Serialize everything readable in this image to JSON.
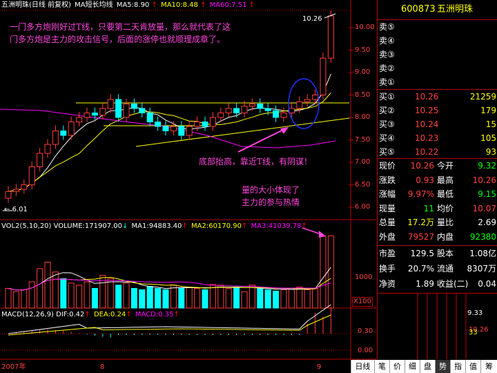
{
  "price_header": {
    "stock_name": "五洲明珠",
    "chart_mode": "(日线 前复权)",
    "indicator": "MA短长均线",
    "ma5": "MA5:8.90",
    "ma10": "MA10:8.48",
    "ma60": "MA60:7.51",
    "up_arrow": "↑"
  },
  "annotations": {
    "top_note_line1": "一门多方炮刚好过T线，只要第二天肯放量，那么就代表了这",
    "top_note_line2": "门多方炮是主力的攻击信号，后面的涨停也就顺理成章了。",
    "bottom_note": "底部抬高，靠近T线，有阴谋！",
    "volume_note_line1": "量的大小体现了",
    "volume_note_line2": "主力的参与热情",
    "high_label": "10.26",
    "low_label": "6.01"
  },
  "price_axis": [
    "10.00",
    "9.50",
    "9.00",
    "8.50",
    "8.00",
    "7.50",
    "7.00",
    "6.50",
    "6.00"
  ],
  "volume_header": {
    "title": "VOL2(5,10,20)",
    "volume": "VOLUME:171907.00",
    "ma1": "MA1:94883.40",
    "ma2": "MA2:60170.90",
    "ma3": "MA3:41039.78",
    "arrow": "↑",
    "down_arrow": "↓"
  },
  "volume_axis": {
    "label": "1000",
    "unit": "X100"
  },
  "macd_header": {
    "title": "MACD(12,26,9)",
    "dif": "DIF:0.42",
    "dea": "DEA:0.24",
    "macd": "MACD:0.35",
    "arrow": "↑"
  },
  "macd_axis": [
    "0.30",
    "0.00"
  ],
  "date_axis": {
    "year": "2007年",
    "mark1": "8",
    "mark2": "9"
  },
  "quote_panel": {
    "code": "600873",
    "name": "五洲明珠",
    "sells": [
      {
        "label": "卖⑤",
        "price": "",
        "vol": ""
      },
      {
        "label": "卖④",
        "price": "",
        "vol": ""
      },
      {
        "label": "卖③",
        "price": "",
        "vol": ""
      },
      {
        "label": "卖②",
        "price": "",
        "vol": ""
      },
      {
        "label": "卖①",
        "price": "",
        "vol": ""
      }
    ],
    "buys": [
      {
        "label": "买①",
        "price": "10.26",
        "vol": "21259"
      },
      {
        "label": "买②",
        "price": "10.25",
        "vol": "179"
      },
      {
        "label": "买③",
        "price": "10.24",
        "vol": "15"
      },
      {
        "label": "买④",
        "price": "10.23",
        "vol": "105"
      },
      {
        "label": "买⑤",
        "price": "10.22",
        "vol": "93"
      }
    ],
    "stats1": [
      {
        "l1": "现价",
        "v1": "10.26",
        "l2": "今开",
        "v2": "9.32"
      },
      {
        "l1": "涨跌",
        "v1": "0.93",
        "l2": "最高",
        "v2": "10.26"
      },
      {
        "l1": "涨幅",
        "v1": "9.97%",
        "l2": "最低",
        "v2": "9.15"
      },
      {
        "l1": "现量",
        "v1": "11",
        "l2": "均价",
        "v2": "10.07"
      },
      {
        "l1": "总量",
        "v1": "17.2万",
        "l2": "量比",
        "v2": "2.69"
      },
      {
        "l1": "外盘",
        "v1": "79527",
        "l2": "内盘",
        "v2": "92380"
      }
    ],
    "stats2": [
      {
        "l1": "市盈",
        "v1": "129.5",
        "l2": "股本",
        "v2": "1.08亿"
      },
      {
        "l1": "换手",
        "v1": "20.7%",
        "l2": "流通",
        "v2": "8307万"
      },
      {
        "l1": "净资",
        "v1": "1.89",
        "l2": "收益(二)",
        "v2": "0.04"
      }
    ],
    "mini_chart": {
      "top": "10.26",
      "mid": "9.33",
      "low": "33"
    }
  },
  "tabs": [
    "日线",
    "笔",
    "价",
    "细",
    "盘",
    "势",
    "指",
    "值",
    "筹"
  ],
  "active_tab": 5,
  "colors": {
    "up": "#ff3c3c",
    "down": "#00ffff",
    "ma5": "#ffffff",
    "ma10": "#ffff00",
    "ma60": "#ff00ff",
    "annotation": "#ff44dd",
    "grid": "#b00000"
  }
}
